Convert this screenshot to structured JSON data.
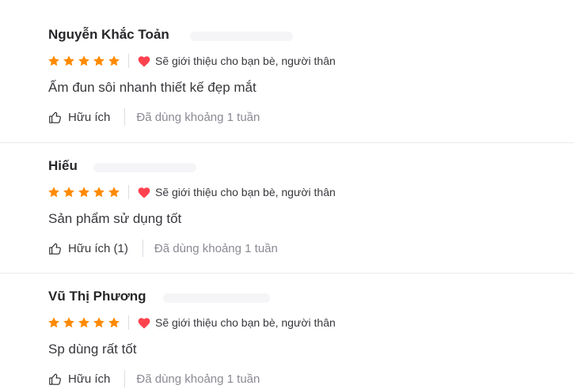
{
  "reviews": [
    {
      "name": "Nguyễn Khắc Toản",
      "stars": 5,
      "recommend": "Sẽ giới thiệu cho bạn bè, người thân",
      "content": "Ấm đun sôi nhanh thiết kế đẹp mắt",
      "helpful": "Hữu ích",
      "usage": "Đã dùng khoảng 1 tuần"
    },
    {
      "name": "Hiếu",
      "stars": 5,
      "recommend": "Sẽ giới thiệu cho bạn bè, người thân",
      "content": "Sản phẩm sử dụng tốt",
      "helpful": "Hữu ích (1)",
      "usage": "Đã dùng khoảng 1 tuần"
    },
    {
      "name": "Vũ Thị Phương",
      "stars": 5,
      "recommend": "Sẽ giới thiệu cho bạn bè, người thân",
      "content": "Sp dùng rất tốt",
      "helpful": "Hữu ích",
      "usage": "Đã dùng khoảng 1 tuần"
    }
  ],
  "colors": {
    "star": "#ff8a00",
    "heart": "#ff424e",
    "divider": "#ebebf0"
  },
  "icons": {
    "star": "star-icon",
    "heart": "heart-icon",
    "like": "thumbs-up-icon"
  }
}
